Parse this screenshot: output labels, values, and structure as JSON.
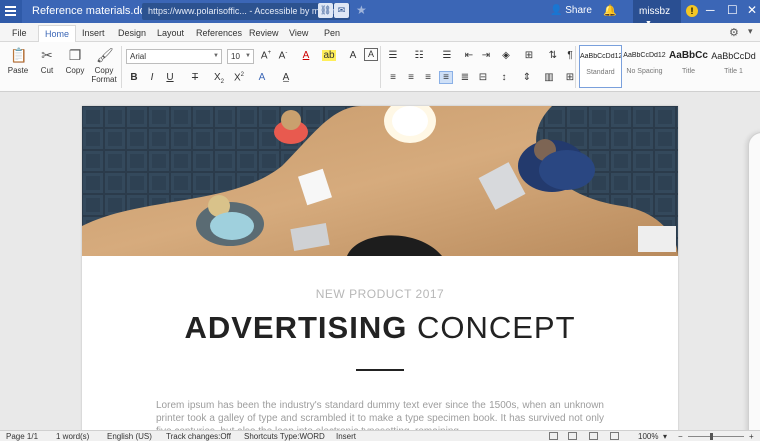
{
  "titlebar": {
    "doc_title": "Reference materials.docx",
    "url": "https://www.polarisoffic... - Accessible by me only",
    "share_label": "Share",
    "user": "missbz",
    "warn_glyph": "!"
  },
  "menu": {
    "tabs": [
      "File",
      "Home",
      "Insert",
      "Design",
      "Layout",
      "References",
      "Review",
      "View",
      "Pen"
    ],
    "active": "Home"
  },
  "toolbar": {
    "paste": "Paste",
    "cut": "Cut",
    "copy": "Copy",
    "copy_format_1": "Copy",
    "copy_format_2": "Format",
    "font": "Arial",
    "size": "10",
    "styles": [
      {
        "sample": "AaBbCcDd12",
        "name": "Standard"
      },
      {
        "sample": "AaBbCcDd12",
        "name": "No Spacing"
      },
      {
        "sample": "AaBbCc",
        "name": "Title"
      },
      {
        "sample": "AaBbCcDd",
        "name": "Title 1"
      }
    ]
  },
  "document": {
    "kicker": "NEW PRODUCT 2017",
    "headline_bold": "ADVERTISING",
    "headline_light": "CONCEPT",
    "lorem": "Lorem ipsum has been the industry's standard dummy text ever since the 1500s, when an unknown printer took a galley of type and scrambled it to make a type specimen book. It has survived not only five centuries, but also the leap into electronic typesetting, remaining"
  },
  "status": {
    "page": "Page 1/1",
    "words": "1 word(s)",
    "language": "English (US)",
    "track": "Track changes:Off",
    "shortcuts": "Shortcuts Type:WORD",
    "mode": "Insert",
    "zoom": "100%"
  },
  "colors": {
    "titlebar": "#3b66b6",
    "accent": "#3b66b6"
  }
}
